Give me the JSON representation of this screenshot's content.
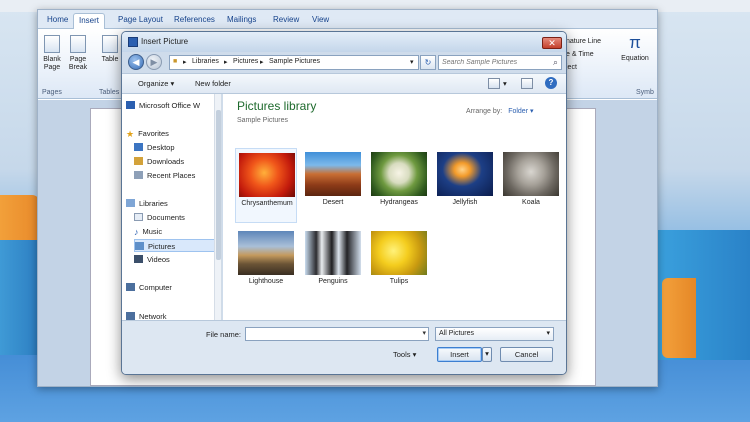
{
  "ribbon": {
    "tabs": [
      "Home",
      "Insert",
      "Page Layout",
      "References",
      "Mailings",
      "Review",
      "View"
    ],
    "active_tab": "Insert",
    "buttons": {
      "blank_page": "Blank Page",
      "page_break": "Page Break",
      "table": "Table",
      "equation": "Equation"
    },
    "groups": {
      "pages": "Pages",
      "tables": "Tables",
      "symbols": "Symb"
    },
    "right_items": [
      "nature Line",
      "e & Time",
      "ject"
    ],
    "symbol": "π"
  },
  "dialog": {
    "title": "Insert Picture",
    "breadcrumb": [
      "Libraries",
      "Pictures",
      "Sample Pictures"
    ],
    "search_placeholder": "Search Sample Pictures",
    "toolbar": {
      "organize": "Organize",
      "new_folder": "New folder"
    },
    "nav": [
      {
        "label": "Microsoft Office W",
        "icon": "word-icon",
        "indent": 0
      },
      {
        "label": "Favorites",
        "icon": "star-icon",
        "indent": 0
      },
      {
        "label": "Desktop",
        "icon": "desktop-icon",
        "indent": 1
      },
      {
        "label": "Downloads",
        "icon": "downloads-icon",
        "indent": 1
      },
      {
        "label": "Recent Places",
        "icon": "recent-places-icon",
        "indent": 1
      },
      {
        "label": "Libraries",
        "icon": "libraries-icon",
        "indent": 0
      },
      {
        "label": "Documents",
        "icon": "documents-icon",
        "indent": 1
      },
      {
        "label": "Music",
        "icon": "music-icon",
        "indent": 1
      },
      {
        "label": "Pictures",
        "icon": "pictures-icon",
        "indent": 1,
        "selected": true
      },
      {
        "label": "Videos",
        "icon": "videos-icon",
        "indent": 1
      },
      {
        "label": "Computer",
        "icon": "computer-icon",
        "indent": 0
      },
      {
        "label": "Network",
        "icon": "network-icon",
        "indent": 0
      }
    ],
    "library_title": "Pictures library",
    "library_subtitle": "Sample Pictures",
    "arrange_by_label": "Arrange by:",
    "arrange_by_value": "Folder",
    "files": [
      "Chrysanthemum",
      "Desert",
      "Hydrangeas",
      "Jellyfish",
      "Koala",
      "Lighthouse",
      "Penguins",
      "Tulips"
    ],
    "file_name_label": "File name:",
    "file_name_value": "",
    "file_type": "All Pictures",
    "tools_label": "Tools",
    "insert_label": "Insert",
    "cancel_label": "Cancel"
  }
}
